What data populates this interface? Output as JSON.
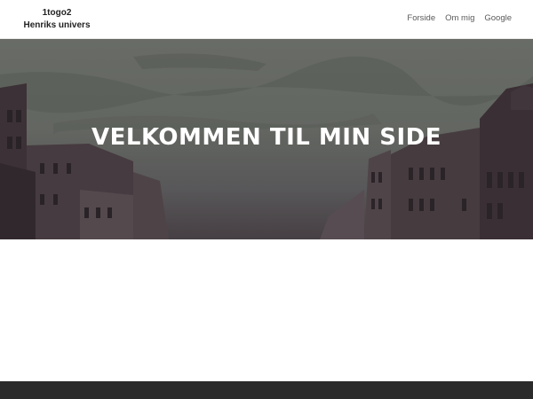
{
  "site": {
    "title": "1togo2",
    "tagline": "Henriks univers"
  },
  "nav": {
    "items": [
      {
        "label": "Forside"
      },
      {
        "label": "Om mig"
      },
      {
        "label": "Google"
      }
    ]
  },
  "hero": {
    "heading": "VELKOMMEN TIL MIN SIDE"
  },
  "colors": {
    "header_bg": "#ffffff",
    "hero_sky": "#6b7069",
    "footer_bg": "#2b2b2b",
    "text": "#222222"
  }
}
